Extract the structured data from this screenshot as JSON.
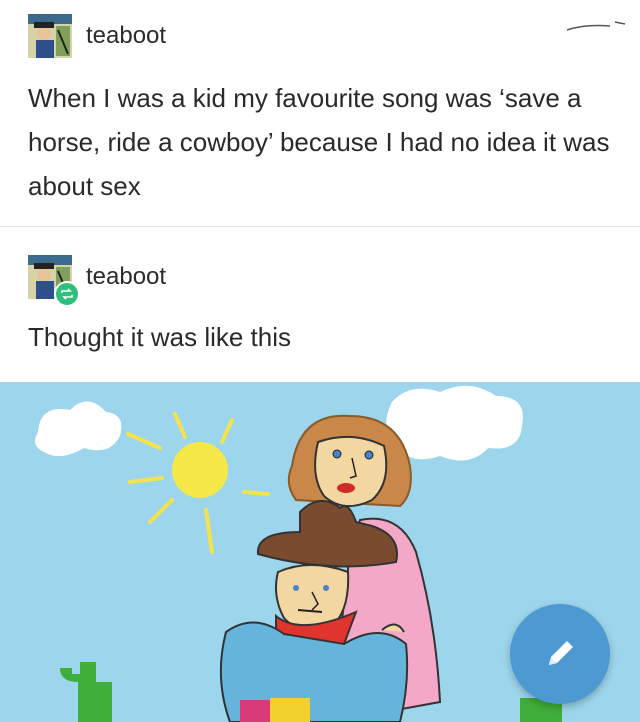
{
  "posts": [
    {
      "username": "teaboot",
      "text": "When I was a kid my favourite song was ‘save a horse, ride a cowboy’ because I had no idea it was about sex",
      "avatar_icon": "comic-avatar-icon"
    },
    {
      "username": "teaboot",
      "text": "Thought it was like this",
      "avatar_icon": "comic-avatar-icon",
      "badge_icon": "reblog-icon"
    }
  ],
  "compose_button": {
    "icon": "pencil-icon"
  },
  "colors": {
    "sky": "#9dd6ec",
    "sun": "#f7e84a",
    "reblog_badge": "#2fbf7a",
    "fab": "#4d9ad2"
  }
}
